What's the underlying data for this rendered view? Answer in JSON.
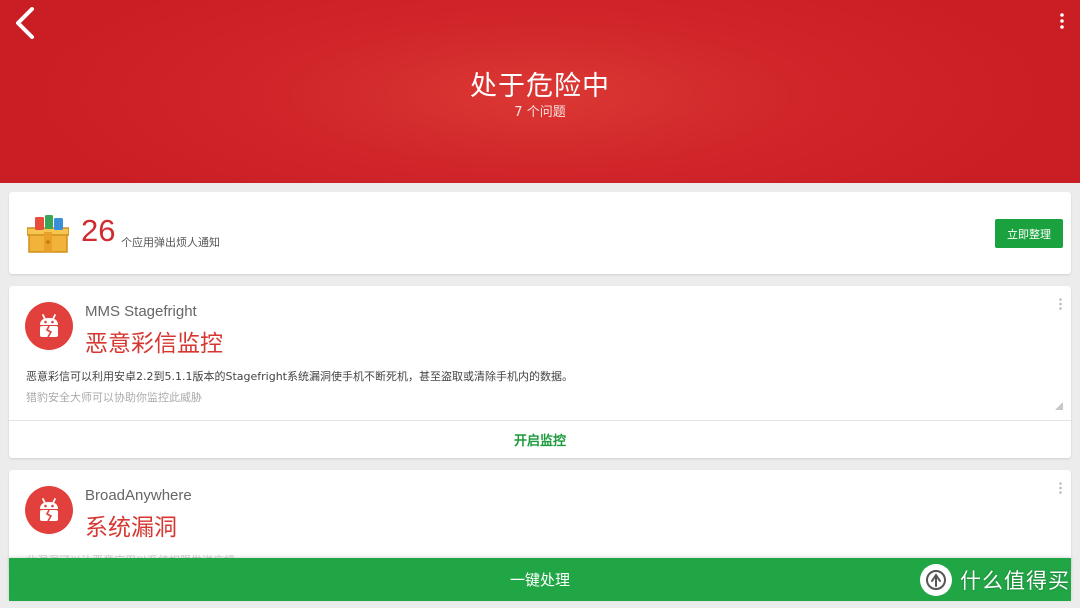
{
  "header": {
    "back_icon": "chevron-left-icon",
    "more_icon": "more-vertical-icon",
    "title": "处于危险中",
    "subtitle": "7 个问题"
  },
  "apps_card": {
    "icon": "gift-box-icon",
    "count": "26",
    "label": "个应用弹出烦人通知",
    "button_label": "立即整理"
  },
  "threats": [
    {
      "icon": "broken-android-icon",
      "name": "MMS Stagefright",
      "type": "恶意彩信监控",
      "description": "恶意彩信可以利用安卓2.2到5.1.1版本的Stagefright系统漏洞使手机不断死机，甚至盗取或清除手机内的数据。",
      "hint": "猎豹安全大师可以协助你监控此威胁",
      "action_label": "开启监控"
    },
    {
      "icon": "broken-android-icon",
      "name": "BroadAnywhere",
      "type": "系统漏洞",
      "description": "此漏洞可以让恶意应用以系统权限发送广播"
    }
  ],
  "bottom_bar": {
    "label": "一键处理"
  },
  "watermark": {
    "text": "什么值得买"
  },
  "colors": {
    "header_red": "#cf2429",
    "threat_red": "#d63731",
    "action_green": "#1aa23f"
  }
}
